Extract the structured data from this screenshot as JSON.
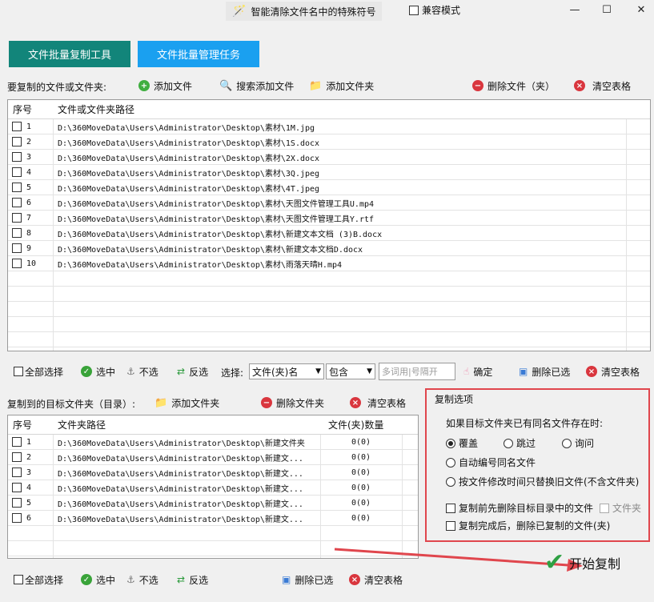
{
  "window": {
    "title": "智能清除文件名中的特殊符号",
    "compat_mode_label": "兼容模式",
    "compat_mode_checked": false,
    "controls": {
      "minimize": "—",
      "maximize": "☐",
      "close": "✕"
    }
  },
  "tabs": [
    {
      "label": "文件批量复制工具",
      "active": true
    },
    {
      "label": "文件批量管理任务",
      "active": false
    }
  ],
  "source": {
    "section_label": "要复制的文件或文件夹:",
    "toolbar": {
      "add_file": "添加文件",
      "search_add_file": "搜索添加文件",
      "add_folder": "添加文件夹",
      "delete_file_folder": "删除文件（夹）",
      "clear_table": "清空表格"
    },
    "columns": {
      "index": "序号",
      "path": "文件或文件夹路径"
    },
    "rows": [
      {
        "index": "1",
        "path": "D:\\360MoveData\\Users\\Administrator\\Desktop\\素材\\1M.jpg"
      },
      {
        "index": "2",
        "path": "D:\\360MoveData\\Users\\Administrator\\Desktop\\素材\\1S.docx"
      },
      {
        "index": "3",
        "path": "D:\\360MoveData\\Users\\Administrator\\Desktop\\素材\\2X.docx"
      },
      {
        "index": "4",
        "path": "D:\\360MoveData\\Users\\Administrator\\Desktop\\素材\\3Q.jpeg"
      },
      {
        "index": "5",
        "path": "D:\\360MoveData\\Users\\Administrator\\Desktop\\素材\\4T.jpeg"
      },
      {
        "index": "6",
        "path": "D:\\360MoveData\\Users\\Administrator\\Desktop\\素材\\天图文件管理工具U.mp4"
      },
      {
        "index": "7",
        "path": "D:\\360MoveData\\Users\\Administrator\\Desktop\\素材\\天图文件管理工具Y.rtf"
      },
      {
        "index": "8",
        "path": "D:\\360MoveData\\Users\\Administrator\\Desktop\\素材\\新建文本文档 (3)B.docx"
      },
      {
        "index": "9",
        "path": "D:\\360MoveData\\Users\\Administrator\\Desktop\\素材\\新建文本文档D.docx"
      },
      {
        "index": "10",
        "path": "D:\\360MoveData\\Users\\Administrator\\Desktop\\素材\\雨落天晴H.mp4"
      }
    ],
    "select_bar": {
      "select_all": "全部选择",
      "select": "选中",
      "deselect": "不选",
      "invert": "反选",
      "select_label": "选择:",
      "field_value": "文件(夹)名",
      "match_value": "包含",
      "keyword_placeholder": "多词用|号隔开",
      "confirm": "确定",
      "delete_selected": "删除已选",
      "clear_table": "清空表格"
    }
  },
  "target": {
    "section_label": "复制到的目标文件夹（目录）:",
    "toolbar": {
      "add_folder": "添加文件夹",
      "delete_folder": "删除文件夹",
      "clear_table": "清空表格"
    },
    "columns": {
      "index": "序号",
      "path": "文件夹路径",
      "count": "文件(夹)数量"
    },
    "rows": [
      {
        "index": "1",
        "path": "D:\\360MoveData\\Users\\Administrator\\Desktop\\新建文件夹",
        "count": "0(0)"
      },
      {
        "index": "2",
        "path": "D:\\360MoveData\\Users\\Administrator\\Desktop\\新建文...",
        "count": "0(0)"
      },
      {
        "index": "3",
        "path": "D:\\360MoveData\\Users\\Administrator\\Desktop\\新建文...",
        "count": "0(0)"
      },
      {
        "index": "4",
        "path": "D:\\360MoveData\\Users\\Administrator\\Desktop\\新建文...",
        "count": "0(0)"
      },
      {
        "index": "5",
        "path": "D:\\360MoveData\\Users\\Administrator\\Desktop\\新建文...",
        "count": "0(0)"
      },
      {
        "index": "6",
        "path": "D:\\360MoveData\\Users\\Administrator\\Desktop\\新建文...",
        "count": "0(0)"
      }
    ],
    "select_bar": {
      "select_all": "全部选择",
      "select": "选中",
      "deselect": "不选",
      "invert": "反选",
      "delete_selected": "删除已选",
      "clear_table": "清空表格"
    }
  },
  "copy_options": {
    "title": "复制选项",
    "question": "如果目标文件夹已有同名文件存在时:",
    "overwrite": "覆盖",
    "skip": "跳过",
    "ask": "询问",
    "auto_number": "自动编号同名文件",
    "replace_by_time": "按文件修改时间只替换旧文件(不含文件夹)",
    "selected": "overwrite",
    "delete_before_copy": "复制前先删除目标目录中的文件",
    "folder_label": "文件夹",
    "delete_after_copy": "复制完成后，删除已复制的文件(夹)"
  },
  "start_button": "开始复制",
  "colors": {
    "tab_active": "#12857a",
    "tab_inactive": "#1aa0f0",
    "highlight": "#e0464d"
  }
}
